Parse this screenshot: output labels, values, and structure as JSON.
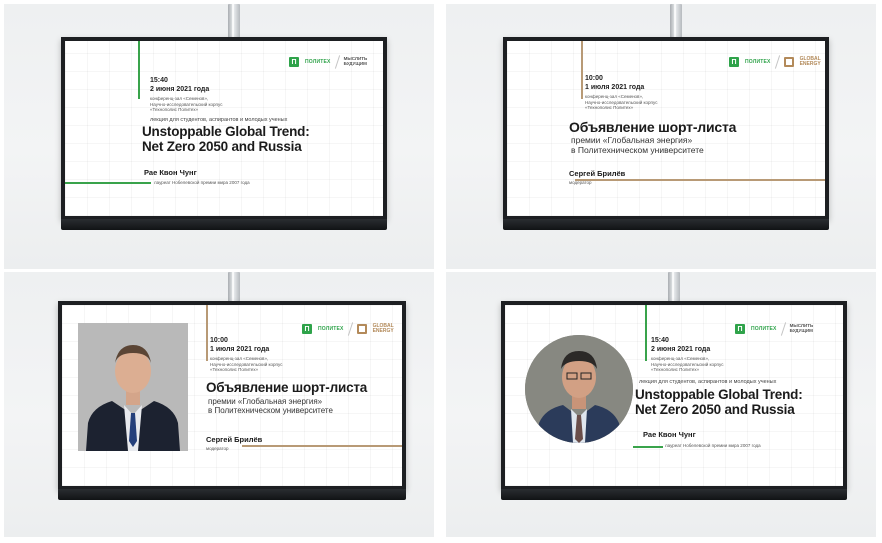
{
  "logos": {
    "politeh_mark": "П",
    "politeh_text": "ПОЛИТЕХ",
    "mysly_text": "МЫСЛИТЬ БУДУЩИМ",
    "ge_text": "GLOBAL ENERGY"
  },
  "lecture": {
    "time": "15:40",
    "date": "2 июня 2021 года",
    "venue": [
      "конференц-зал «Семенов»,",
      "Научно-исследовательский корпус",
      "«Технополис Политех»"
    ],
    "audience": "лекция для студентов, аспирантов и молодых ученых",
    "title_line1": "Unstoppable Global Trend:",
    "title_line2": "Net Zero 2050 and Russia",
    "speaker": "Рае Квон Чунг",
    "speaker_role": "лауреат Нобелевской премии мира 2007 года"
  },
  "shortlist": {
    "time": "10:00",
    "date": "1 июля 2021 года",
    "venue": [
      "конференц-зал «Семенов»,",
      "Научно-исследовательский корпус",
      "«Технополис Политех»"
    ],
    "title": "Объявление шорт-листа",
    "subtitle_line1": "премии «Глобальная энергия»",
    "subtitle_line2": "в Политехническом университете",
    "speaker": "Сергей Брилёв",
    "speaker_role": "модератор"
  },
  "colors": {
    "green_accent": "#39a34b",
    "tan_accent": "#b89a76",
    "screen_frame": "#1d1f22"
  }
}
